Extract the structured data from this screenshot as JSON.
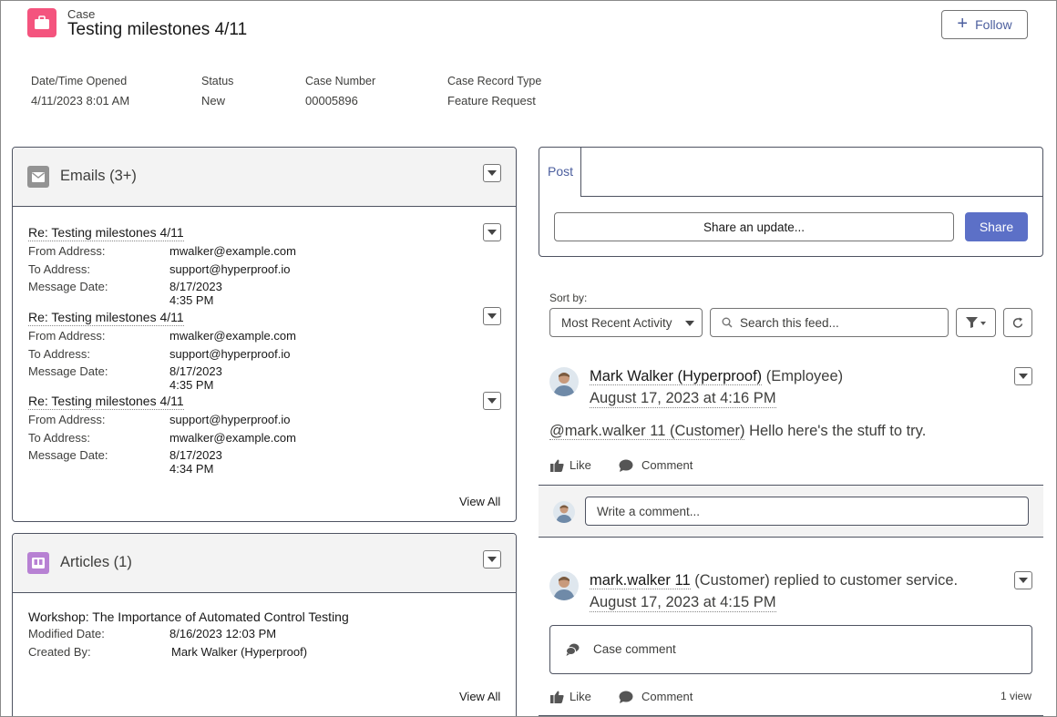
{
  "header": {
    "object_type": "Case",
    "title": "Testing milestones 4/11",
    "follow_label": "Follow",
    "fields": [
      {
        "label": "Date/Time Opened",
        "value": "4/11/2023 8:01 AM"
      },
      {
        "label": "Status",
        "value": "New"
      },
      {
        "label": "Case Number",
        "value": "00005896"
      },
      {
        "label": "Case Record Type",
        "value": "Feature Request"
      }
    ]
  },
  "emails": {
    "title": "Emails (3+)",
    "items": [
      {
        "subject": "Re: Testing milestones 4/11",
        "from_label": "From Address:",
        "from": "mwalker@example.com",
        "to_label": "To Address:",
        "to": "support@hyperproof.io",
        "date_label": "Message Date:",
        "date": "8/17/2023 4:35 PM"
      },
      {
        "subject": "Re: Testing milestones 4/11",
        "from_label": "From Address:",
        "from": "mwalker@example.com",
        "to_label": "To Address:",
        "to": "support@hyperproof.io",
        "date_label": "Message Date:",
        "date": "8/17/2023 4:35 PM"
      },
      {
        "subject": "Re: Testing milestones 4/11",
        "from_label": "From Address:",
        "from": "support@hyperproof.io",
        "to_label": "To Address:",
        "to": "mwalker@example.com",
        "date_label": "Message Date:",
        "date": "8/17/2023 4:34 PM"
      }
    ],
    "view_all": "View All"
  },
  "articles": {
    "title": "Articles (1)",
    "item": {
      "title": "Workshop: The Importance of Automated Control Testing",
      "modified_label": "Modified Date:",
      "modified": "8/16/2023 12:03 PM",
      "created_label": "Created By:",
      "created_by": "Mark Walker (Hyperproof)"
    },
    "view_all": "View All"
  },
  "publisher": {
    "tab": "Post",
    "placeholder": "Share an update...",
    "share_label": "Share"
  },
  "feed": {
    "sort_label": "Sort by:",
    "sort_value": "Most Recent Activity",
    "search_placeholder": "Search this feed...",
    "posts": [
      {
        "author": "Mark Walker (Hyperproof)",
        "author_suffix": " (Employee)",
        "date": "August 17, 2023 at 4:16 PM",
        "mention": "@mark.walker 11 (Customer)",
        "body": " Hello here's the stuff to try.",
        "like": "Like",
        "comment": "Comment",
        "comment_placeholder": "Write a comment..."
      },
      {
        "author": "mark.walker 11",
        "author_suffix": " (Customer) replied to customer service.",
        "date": "August 17, 2023 at 4:15 PM",
        "case_comment": "Case comment",
        "like": "Like",
        "comment": "Comment",
        "views": "1 view"
      }
    ]
  },
  "colors": {
    "case_icon": "#f4547e",
    "articles_icon": "#b781d3",
    "emails_icon": "#939393",
    "brand": "#5c70c7",
    "link": "#4b5e9e"
  }
}
